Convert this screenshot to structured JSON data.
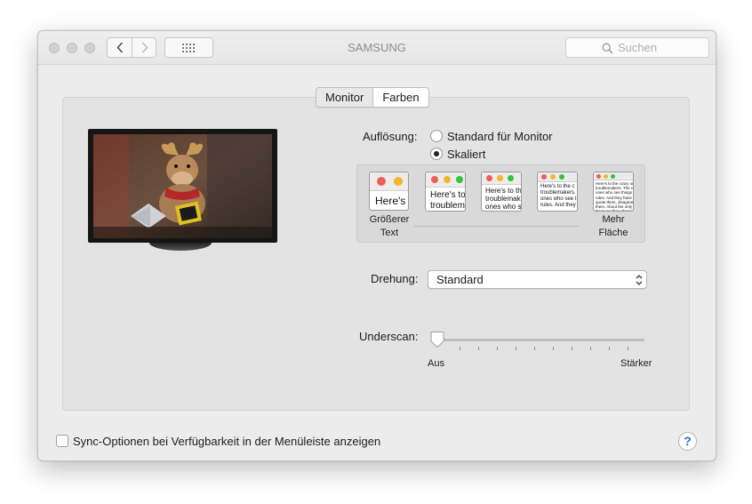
{
  "window": {
    "title": "SAMSUNG",
    "search_placeholder": "Suchen",
    "nav": {
      "back_icon": "chevron-left-icon",
      "forward_icon": "chevron-right-icon",
      "grid_icon": "grid-icon"
    }
  },
  "tabs": [
    {
      "label": "Monitor",
      "selected": true
    },
    {
      "label": "Farben",
      "selected": false
    }
  ],
  "resolution": {
    "label": "Auflösung:",
    "options": [
      {
        "label": "Standard für Monitor",
        "selected": false
      },
      {
        "label": "Skaliert",
        "selected": true
      }
    ],
    "scale_thumbnails": [
      "Here's",
      "Here's to\ntroublem",
      "Here's to th\ntroublemake\nones who se",
      "Here's to the c\ntroublemakers.\nones who see t\nrules. And they",
      "Here's to the crazy one\ntroublemakers. The rou\nones who see things dif\nrules. And they have no\nquote them, disagree w\nthem. About the only th\nBecause they change th"
    ],
    "left_caption_1": "Größerer",
    "left_caption_2": "Text",
    "right_caption_1": "Mehr",
    "right_caption_2": "Fläche"
  },
  "rotation": {
    "label": "Drehung:",
    "value": "Standard"
  },
  "underscan": {
    "label": "Underscan:",
    "min_label": "Aus",
    "max_label": "Stärker",
    "value_fraction": 0.0
  },
  "footer": {
    "sync_label": "Sync-Optionen bei Verfügbarkeit in der Menüleiste anzeigen",
    "sync_checked": false,
    "help_label": "?"
  },
  "colors": {
    "traffic_red": "#ee5e56",
    "traffic_yellow": "#f5b52e",
    "traffic_green": "#2fc53f",
    "accent_blue": "#2e6bd6"
  }
}
